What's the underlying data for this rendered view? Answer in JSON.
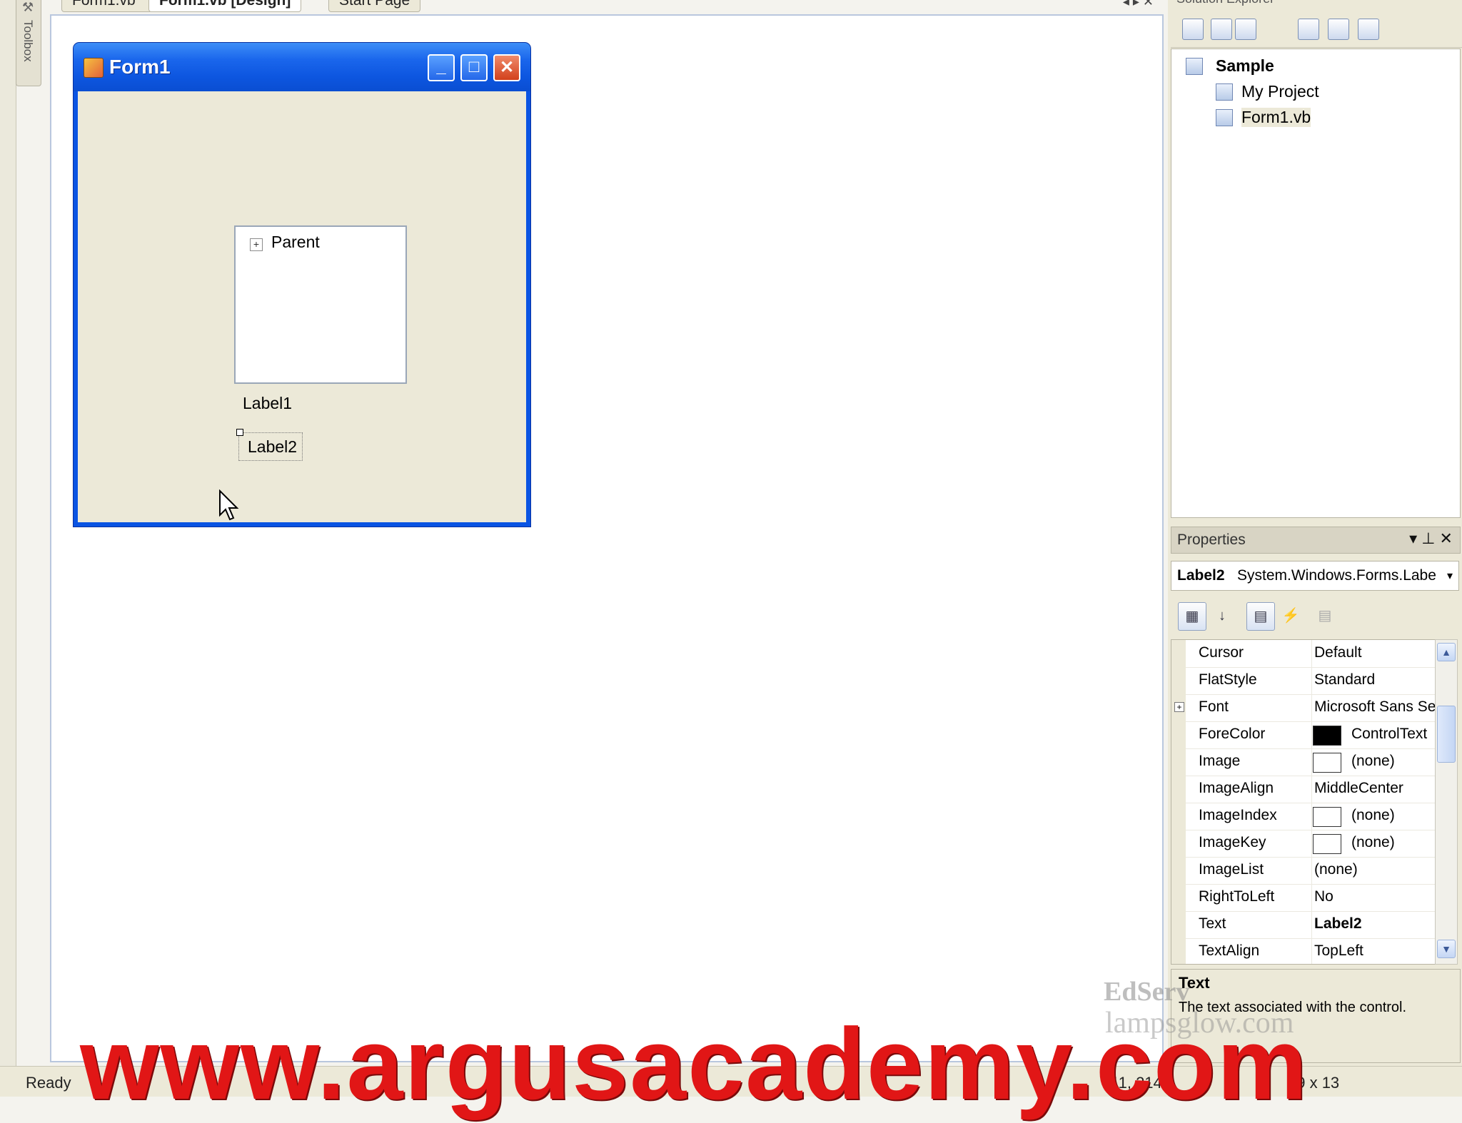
{
  "toolbox": {
    "label": "Toolbox"
  },
  "doc_tabs": [
    {
      "label": "Form1.vb*"
    },
    {
      "label": "Form1.vb [Design]"
    },
    {
      "label": "Start Page"
    }
  ],
  "doc_tab_controls": "◂ ▸ ✕",
  "form": {
    "title": "Form1",
    "min_glyph": "_",
    "max_glyph": "□",
    "close_glyph": "✕",
    "tree_node": "Parent",
    "tree_expander": "+",
    "label1": "Label1",
    "label2": "Label2"
  },
  "solution_explorer": {
    "title": "Solution Explorer",
    "solution": "Sample",
    "items": [
      "My Project",
      "Form1.vb"
    ]
  },
  "properties": {
    "title": "Properties",
    "header_buttons": "▾ ⊥ ✕",
    "object_name": "Label2",
    "object_type": "System.Windows.Forms.Labe",
    "object_arrow": "▾",
    "toolbar_buttons": [
      "categorized",
      "alphabetical",
      "properties",
      "events",
      "property-pages"
    ],
    "rows": [
      {
        "name": "Cursor",
        "value": "Default"
      },
      {
        "name": "FlatStyle",
        "value": "Standard"
      },
      {
        "name": "Font",
        "value": "Microsoft Sans Se",
        "expandable": true
      },
      {
        "name": "ForeColor",
        "value": "ControlText",
        "swatch": "#000000"
      },
      {
        "name": "Image",
        "value": "(none)",
        "swatch": "#ffffff"
      },
      {
        "name": "ImageAlign",
        "value": "MiddleCenter"
      },
      {
        "name": "ImageIndex",
        "value": "(none)",
        "swatch": "#ffffff"
      },
      {
        "name": "ImageKey",
        "value": "(none)",
        "swatch": "#ffffff"
      },
      {
        "name": "ImageList",
        "value": "(none)"
      },
      {
        "name": "RightToLeft",
        "value": "No"
      },
      {
        "name": "Text",
        "value": "Label2",
        "bold": true
      },
      {
        "name": "TextAlign",
        "value": "TopLeft"
      }
    ],
    "description_title": "Text",
    "description_text": "The text associated with the control."
  },
  "status": {
    "text": "Ready",
    "position": "11, 214",
    "size": "39 x 13"
  },
  "watermarks": {
    "edserv": "EdServ",
    "lamps": "lampsglow.com",
    "argus": "www.argusacademy.com"
  },
  "colors": {
    "xp_title_blue": "#0a54e3",
    "control_face": "#ece9d8",
    "watermark_red": "#e11616"
  }
}
